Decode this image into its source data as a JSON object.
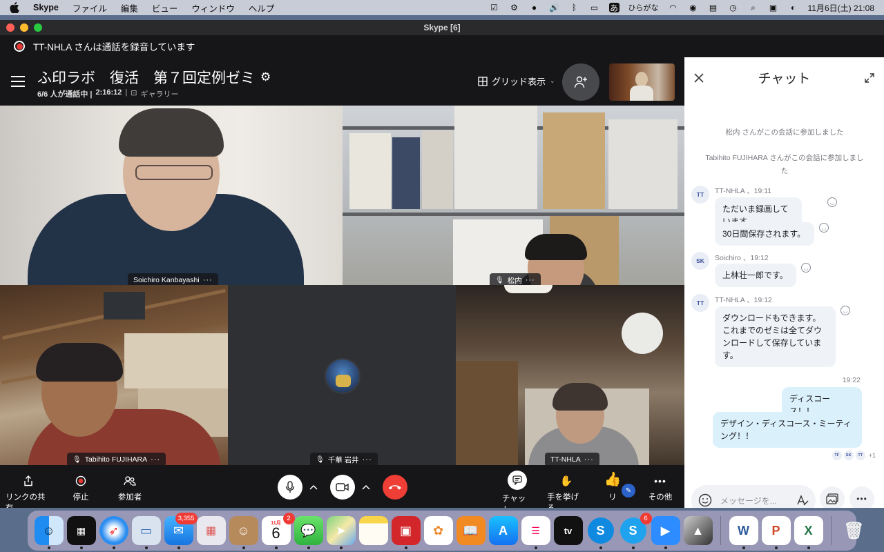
{
  "menubar": {
    "app_name": "Skype",
    "items": [
      "ファイル",
      "編集",
      "ビュー",
      "ウィンドウ",
      "ヘルプ"
    ],
    "input_method": "ひらがな",
    "ime_badge": "あ",
    "datetime": "11月6日(土)  21:08"
  },
  "window": {
    "title": "Skype [6]"
  },
  "recording": {
    "text": "TT-NHLA さんは通話を録音しています"
  },
  "call": {
    "title": "ふ印ラボ　復活　第７回定例ゼミ",
    "participants_status": "6/6 人が通話中 |",
    "duration": "2:16:12",
    "separator": "|",
    "view_label": "ギャラリー",
    "grid_toggle": "グリッド表示"
  },
  "tiles": {
    "t1_name": "Soichiro Kanbayashi",
    "t2_name": "松内",
    "t3_name": "Tabihito FUJIHARA",
    "t4_name": "千華 岩井",
    "t5_name": "TT-NHLA",
    "more": "···"
  },
  "controls": {
    "share": "リンクの共有",
    "stop": "停止",
    "participants": "参加者",
    "chat": "チャット",
    "raise_hand": "手を挙げる",
    "react": "リ",
    "more": "その他"
  },
  "chat": {
    "title": "チャット",
    "system": [
      "松内 さんがこの会話に参加しました",
      "Tabihito FUJIHARA さんがこの会話に参加しました"
    ],
    "groups": [
      {
        "avatar": "TT",
        "header": "TT-NHLA 、19:11",
        "messages": [
          "ただいま録画しています",
          "30日間保存されます。"
        ]
      },
      {
        "avatar": "SK",
        "header": "Soichiro 、19:12",
        "messages": [
          "上林壮一郎です。"
        ]
      },
      {
        "avatar": "TT",
        "header": "TT-NHLA 、19:12",
        "messages": [
          "ダウンロードもできます。これまでのゼミは全てダウンロードして保存しています。"
        ]
      }
    ],
    "outgoing_time": "19:22",
    "outgoing": [
      "ディスコース！！",
      "デザイン・ディスコース・ミーティング！！"
    ],
    "readers": [
      "TF",
      "SK",
      "TT"
    ],
    "readers_more": "+1",
    "placeholder": "メッセージを..."
  },
  "dock": {
    "mail_badge": "3,355",
    "calendar_badge": "2",
    "calendar_month": "11月",
    "calendar_day": "6",
    "skype2_badge": "6",
    "appletv": "tv"
  },
  "colors": {
    "record_red": "#e53935",
    "end_call_red": "#ef3e36",
    "accent_blue": "#3a4f9a",
    "outgoing_bubble": "#daf1fc"
  }
}
